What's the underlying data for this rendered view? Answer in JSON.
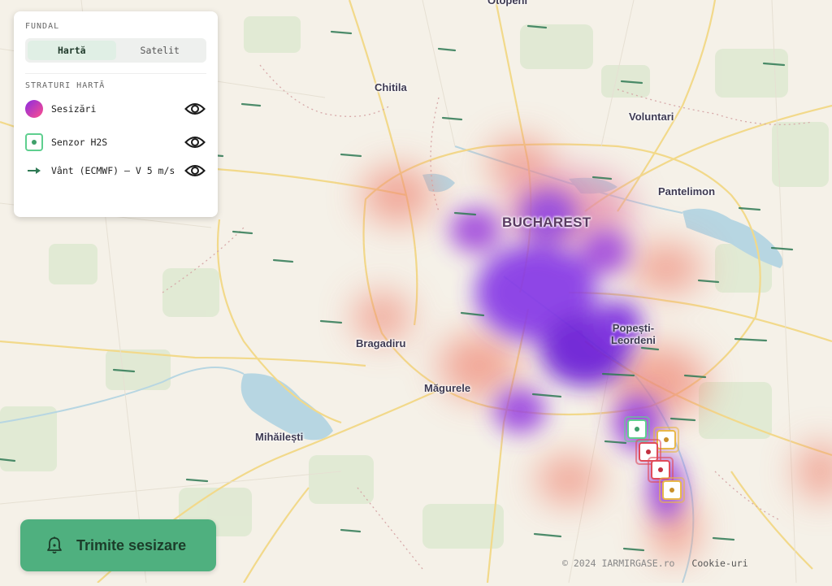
{
  "map": {
    "cities": [
      {
        "id": "otopeni",
        "label": "Otopeni"
      },
      {
        "id": "chitila",
        "label": "Chitila"
      },
      {
        "id": "voluntari",
        "label": "Voluntari"
      },
      {
        "id": "pantelimon",
        "label": "Pantelimon"
      },
      {
        "id": "bucharest",
        "label": "BUCHAREST"
      },
      {
        "id": "popesti",
        "label": "Popești-\nLeordeni"
      },
      {
        "id": "bragadiru",
        "label": "Bragadiru"
      },
      {
        "id": "magurele",
        "label": "Măgurele"
      },
      {
        "id": "mihailesti",
        "label": "Mihăilești"
      }
    ],
    "sensors": [
      {
        "status": "ok",
        "color": "#5fcf8f"
      },
      {
        "status": "warning",
        "color": "#e8b84a"
      },
      {
        "status": "alert",
        "color": "#e04b5a"
      },
      {
        "status": "alert",
        "color": "#e04b5a"
      },
      {
        "status": "warning",
        "color": "#e8b84a"
      }
    ]
  },
  "panel": {
    "background_title": "FUNDAL",
    "background_options": [
      "Hartă",
      "Satelit"
    ],
    "background_selected": "Hartă",
    "layers_title": "STRATURI HARTĂ",
    "layers": [
      {
        "label": "Sesizări",
        "icon": "heatmap-gradient-icon",
        "visible": true
      },
      {
        "label": "Senzor H2S",
        "icon": "sensor-square-icon",
        "visible": true
      },
      {
        "label": "Vânt (ECMWF) — V 5 m/s",
        "icon": "wind-arrow-icon",
        "visible": true
      }
    ]
  },
  "cta": {
    "label": "Trimite sesizare",
    "icon": "bell-icon"
  },
  "footer": {
    "copyright": "© 2024 IARMIRGASE.ro",
    "cookie": "Cookie-uri"
  },
  "colors": {
    "accent": "#4fb07f",
    "heat_low": "#f08c7a",
    "heat_high": "#6a1fd6",
    "wind": "#2f7a55"
  }
}
